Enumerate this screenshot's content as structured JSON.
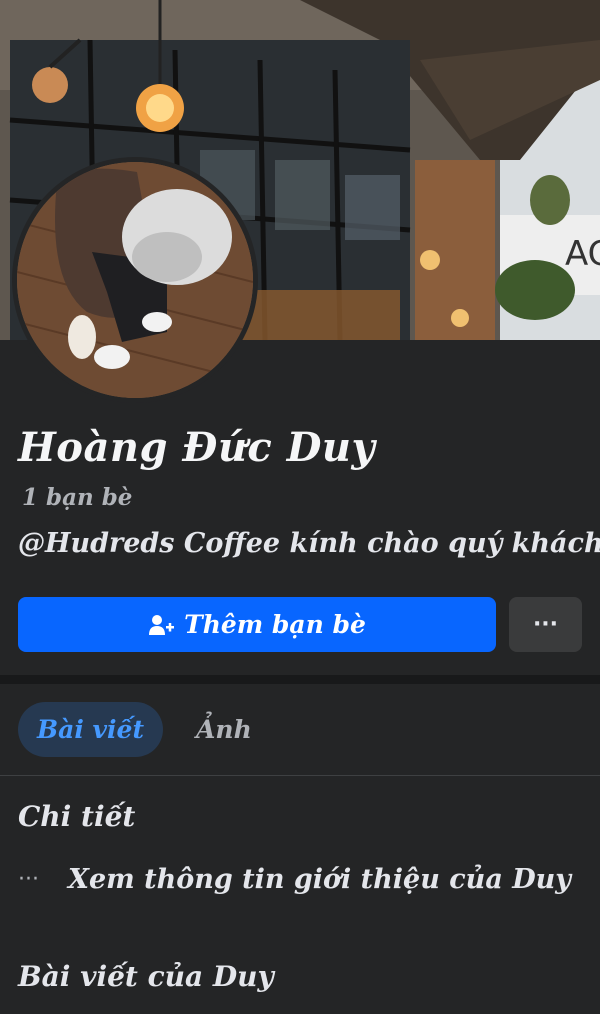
{
  "profile": {
    "name": "Hoàng Đức Duy",
    "friends_count": "1 bạn bè",
    "bio": "@Hudreds Coffee kính chào quý khách"
  },
  "actions": {
    "add_friend_label": "Thêm bạn bè",
    "more_label": "···"
  },
  "tabs": [
    {
      "label": "Bài viết",
      "active": true
    },
    {
      "label": "Ảnh",
      "active": false
    }
  ],
  "details": {
    "title": "Chi tiết",
    "intro_label": "Xem thông tin giới thiệu của Duy",
    "intro_icon": "···"
  },
  "posts": {
    "title": "Bài viết của Duy"
  },
  "cover": {
    "sign_text": "AC"
  },
  "colors": {
    "background": "#242526",
    "primary_button": "#0866ff",
    "secondary_button": "#3a3b3c",
    "active_tab_bg": "#263951",
    "active_tab_text": "#4599ff"
  }
}
